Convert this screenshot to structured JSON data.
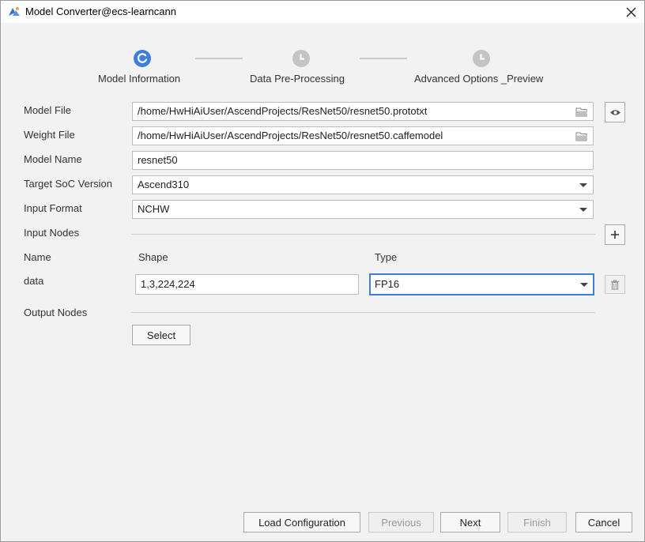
{
  "window": {
    "title": "Model Converter@ecs-learncann"
  },
  "steps": [
    {
      "label": "Model Information",
      "state": "active"
    },
    {
      "label": "Data Pre-Processing",
      "state": "pending"
    },
    {
      "label": "Advanced Options _Preview",
      "state": "pending"
    }
  ],
  "form": {
    "model_file": {
      "label": "Model File",
      "value": "/home/HwHiAiUser/AscendProjects/ResNet50/resnet50.prototxt"
    },
    "weight_file": {
      "label": "Weight File",
      "value": "/home/HwHiAiUser/AscendProjects/ResNet50/resnet50.caffemodel"
    },
    "model_name": {
      "label": "Model Name",
      "value": "resnet50"
    },
    "target_soc": {
      "label": "Target SoC Version",
      "value": "Ascend310"
    },
    "input_format": {
      "label": "Input Format",
      "value": "NCHW"
    },
    "input_nodes": {
      "label": "Input Nodes",
      "columns": {
        "name": "Name",
        "shape": "Shape",
        "type": "Type"
      },
      "rows": [
        {
          "name": "data",
          "shape": "1,3,224,224",
          "type": "FP16"
        }
      ]
    },
    "output_nodes": {
      "label": "Output Nodes",
      "select_label": "Select"
    }
  },
  "footer": {
    "load_config": "Load Configuration",
    "previous": "Previous",
    "next": "Next",
    "finish": "Finish",
    "cancel": "Cancel"
  },
  "colors": {
    "accent": "#3f7fd9",
    "step_pending": "#c4c4c4"
  }
}
